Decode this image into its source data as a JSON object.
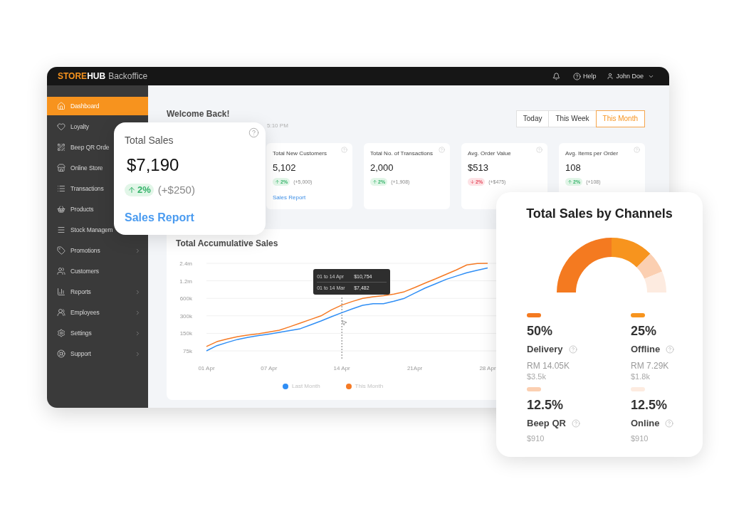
{
  "top_bar": {
    "logo": {
      "accent": "STORE",
      "rest": "HUB",
      "product": "Backoffice"
    },
    "help": "Help",
    "user": "John Doe"
  },
  "sidebar": {
    "items": [
      {
        "label": "Dashboard",
        "selected": true,
        "expandable": false
      },
      {
        "label": "Loyalty",
        "selected": false,
        "expandable": false
      },
      {
        "label": "Beep QR Orde",
        "selected": false,
        "expandable": false
      },
      {
        "label": "Online Store",
        "selected": false,
        "expandable": false
      },
      {
        "label": "Transactions",
        "selected": false,
        "expandable": false
      },
      {
        "label": "Products",
        "selected": false,
        "expandable": false
      },
      {
        "label": "Stock Managem",
        "selected": false,
        "expandable": false
      },
      {
        "label": "Promotions",
        "selected": false,
        "expandable": true
      },
      {
        "label": "Customers",
        "selected": false,
        "expandable": false
      },
      {
        "label": "Reports",
        "selected": false,
        "expandable": true
      },
      {
        "label": "Employees",
        "selected": false,
        "expandable": true
      },
      {
        "label": "Settings",
        "selected": false,
        "expandable": true
      },
      {
        "label": "Support",
        "selected": false,
        "expandable": true
      }
    ]
  },
  "header": {
    "title": "Welcome Back!",
    "subtitle": "5:10 PM"
  },
  "range_tabs": [
    {
      "label": "Today",
      "selected": false
    },
    {
      "label": "This Week",
      "selected": false
    },
    {
      "label": "This Month",
      "selected": true
    }
  ],
  "stat_cards": [
    {
      "title": "Total New Customers",
      "value": "5,102",
      "trend": {
        "kind": "up",
        "percent": "2%",
        "delta": "(+5,000)"
      },
      "link": "Sales Report"
    },
    {
      "title": "Total No. of Transactions",
      "value": "2,000",
      "trend": {
        "kind": "up",
        "percent": "2%",
        "delta": "(+1,908)"
      }
    },
    {
      "title": "Avg. Order Value",
      "value": "$513",
      "trend": {
        "kind": "down",
        "percent": "2%",
        "delta": "(+$475)"
      }
    },
    {
      "title": "Avg. Items per Order",
      "value": "108",
      "trend": {
        "kind": "up",
        "percent": "2%",
        "delta": "(+108)"
      }
    }
  ],
  "accumulative_sales": {
    "title": "Total Accumulative Sales",
    "chart_data": {
      "type": "line",
      "categories": [
        "01 Apr",
        null,
        null,
        null,
        null,
        null,
        "07 Apr",
        null,
        null,
        null,
        null,
        null,
        null,
        "14 Apr",
        null,
        null,
        null,
        null,
        null,
        null,
        "21Apr",
        null,
        null,
        null,
        null,
        null,
        null,
        "28 Apr"
      ],
      "series": [
        {
          "name": "Last Month",
          "color": "#2f8ef5",
          "values": [
            75000,
            92000,
            105000,
            118000,
            128000,
            137000,
            146000,
            156000,
            167000,
            180000,
            210000,
            245000,
            290000,
            340000,
            395000,
            455000,
            484000,
            484000,
            535000,
            600000,
            740000,
            900000,
            1070000,
            1270000,
            1450000,
            1650000,
            1820000,
            2000000
          ]
        },
        {
          "name": "This Month",
          "color": "#f57a25",
          "values": [
            89000,
            108000,
            120000,
            132000,
            140000,
            148000,
            158000,
            170000,
            195000,
            225000,
            260000,
            300000,
            380000,
            460000,
            530000,
            600000,
            640000,
            665000,
            710000,
            780000,
            920000,
            1100000,
            1300000,
            1550000,
            1850000,
            2250000,
            2380000,
            2400000
          ]
        }
      ],
      "ylim": [
        75000,
        2400000
      ],
      "log": true,
      "grid": true,
      "yticks": [
        {
          "value": 2400000,
          "label": "2.4m"
        },
        {
          "value": 1200000,
          "label": "1.2m"
        },
        {
          "value": 600000,
          "label": "600k"
        },
        {
          "value": 300000,
          "label": "300k"
        },
        {
          "value": 150000,
          "label": "150k"
        },
        {
          "value": 75000,
          "label": "75k"
        }
      ],
      "annotations": [
        {
          "x": "14 Apr"
        }
      ]
    },
    "tooltip": {
      "rows": [
        {
          "label": "01 to 14 Apr",
          "value": "$10,754"
        },
        {
          "label": "01 to 14 Mar",
          "value": "$7,482"
        }
      ]
    }
  },
  "total_sales_card": {
    "title": "Total Sales",
    "value": "$7,190",
    "trend": {
      "kind": "up",
      "percent": "2%",
      "delta": "(+$250)"
    },
    "link": "Sales Report"
  },
  "channels_card": {
    "title": "Total Sales by Channels",
    "chart_data": {
      "type": "donut",
      "categories": [
        "Delivery",
        "Offline",
        "Beep QR",
        "Online"
      ],
      "values": [
        50,
        25,
        12.5,
        12.5
      ]
    },
    "items": [
      {
        "color": "#f47a20",
        "percent": "50%",
        "rm": "RM 14.05K",
        "usd": "$3.5k"
      },
      {
        "color": "#f7941e",
        "percent": "25%",
        "rm": "RM 7.29K",
        "usd": "$1.8k"
      },
      {
        "color": "#fbcfb1",
        "percent": "12.5%",
        "usd": "$910"
      },
      {
        "color": "#fdebe0",
        "percent": "12.5%",
        "usd": "$910"
      }
    ]
  }
}
